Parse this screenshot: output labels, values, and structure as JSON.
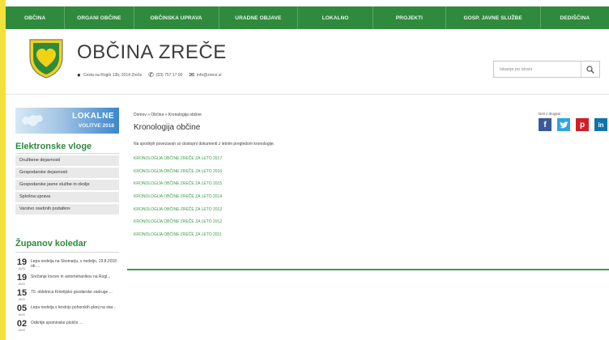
{
  "nav": {
    "items": [
      "OBČINA",
      "ORGANI OBČINE",
      "OBČINSKA UPRAVA",
      "URADNE OBJAVE",
      "LOKALNO",
      "PROJEKTI",
      "GOSP. JAVNE SLUŽBE",
      "DEDIŠČINA"
    ]
  },
  "header": {
    "site_title": "OBČINA ZREČE",
    "address": "Cesta na Roglo 13b, 3214 Zreče",
    "phone": "(03) 757 17 00",
    "email": "info@zrece.si",
    "search_placeholder": "Iskanje po strani",
    "colors": {
      "nav": "#2f8a3d",
      "logo_shield": "#2f8a3d",
      "logo_heart": "#f2d214"
    }
  },
  "sidebar": {
    "banner": {
      "line1": "LOKALNE",
      "line2": "VOLITVE 2018"
    },
    "eforms_heading": "Elektronske vloge",
    "eforms": [
      "Družbene dejavnosti",
      "Gospodarske dejavnosti",
      "Gospodarske javne službe in okolje",
      "Splošna uprava",
      "Varstvo osebnih podatkov"
    ],
    "calendar_heading": "Županov koledar",
    "events": [
      {
        "day": "19",
        "month": "AVG",
        "text": "Lepa nedelja na Skomarju, v nedeljo, 19.8.2018 ob ..."
      },
      {
        "day": "19",
        "month": "AVG",
        "text": "Srečanje lovcev in avtomehanikov na Rogl..."
      },
      {
        "day": "15",
        "month": "AVG",
        "text": "70. obletnica Kmetijsko gozdarske zadruge ..."
      },
      {
        "day": "05",
        "month": "AVG",
        "text": "Lepa nedelja s kostnjo pohorskih planj na star..."
      },
      {
        "day": "02",
        "month": "AVG",
        "text": "Odkritje spominske plošče ..."
      }
    ]
  },
  "main": {
    "breadcrumb": "Domov » Občina » Kronologija občine",
    "title": "Kronologija občine",
    "intro": "Na spodnjih povezavah so dostopni dokumenti z letnim pregledom kronologije.",
    "documents": [
      "KRONOLOGIJA OBČINE ZREČE ZA LETO 2017",
      "KRONOLOGIJA OBČINE ZREČE ZA LETO 2016",
      "KRONOLOGIJA OBČINE ZREČE ZA LETO 2015",
      "KRONOLOGIJA OBČINE ZREČE ZA LETO 2014",
      "KRONOLOGIJA OBČINE ZREČE ZA LETO 2013",
      "KRONOLOGIJA OBČINE ZREČE ZA LETO 2012",
      "KRONOLOGIJA OBČINE ZREČE ZA LETO 2011"
    ],
    "share_label": "Deli z drugimi",
    "share_icons": [
      "facebook-icon",
      "twitter-icon",
      "pinterest-icon",
      "linkedin-icon"
    ]
  }
}
